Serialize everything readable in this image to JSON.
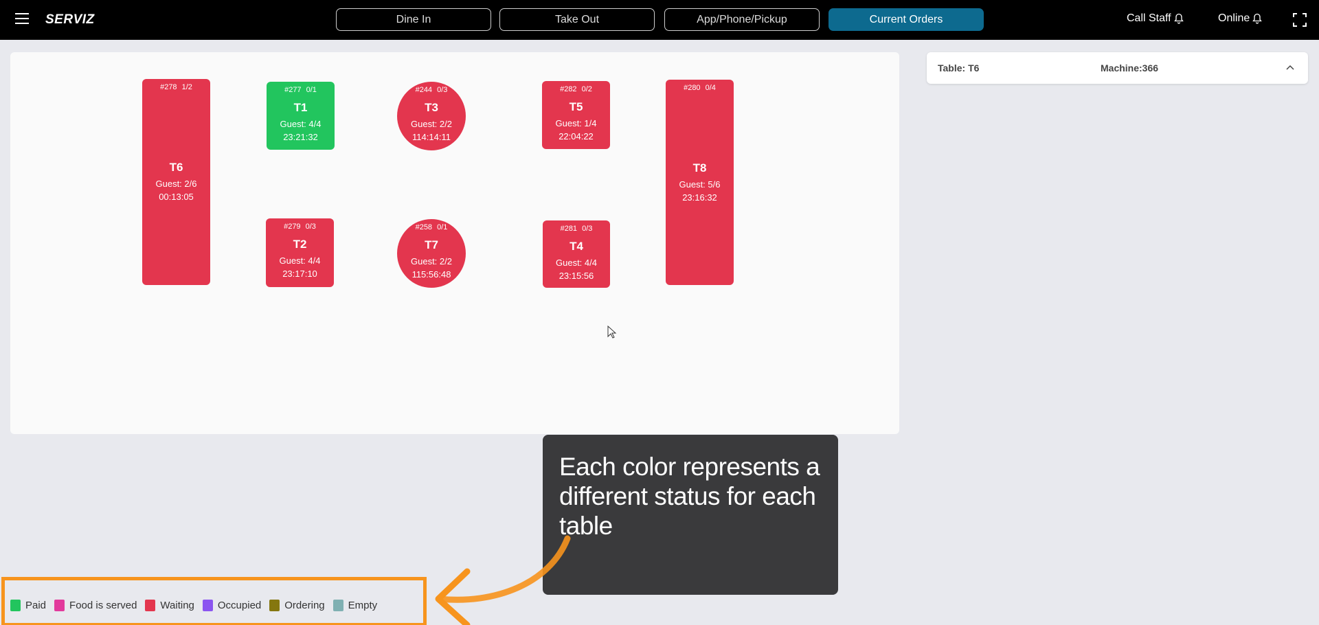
{
  "header": {
    "brand": "SERVIZ",
    "nav": [
      {
        "label": "Dine In",
        "active": false
      },
      {
        "label": "Take Out",
        "active": false
      },
      {
        "label": "App/Phone/Pickup",
        "active": false
      },
      {
        "label": "Current Orders",
        "active": true
      }
    ],
    "call_staff": "Call Staff",
    "online": "Online",
    "accent": "#0d6a8f"
  },
  "tables": [
    {
      "id": "T6",
      "order": "#278",
      "progress": "1/2",
      "guests": "Guest: 2/6",
      "time": "00:13:05",
      "shape": "rect",
      "status": "Waiting"
    },
    {
      "id": "T1",
      "order": "#277",
      "progress": "0/1",
      "guests": "Guest: 4/4",
      "time": "23:21:32",
      "shape": "square",
      "status": "Paid"
    },
    {
      "id": "T3",
      "order": "#244",
      "progress": "0/3",
      "guests": "Guest: 2/2",
      "time": "114:14:11",
      "shape": "round",
      "status": "Waiting"
    },
    {
      "id": "T5",
      "order": "#282",
      "progress": "0/2",
      "guests": "Guest: 1/4",
      "time": "22:04:22",
      "shape": "square",
      "status": "Waiting"
    },
    {
      "id": "T8",
      "order": "#280",
      "progress": "0/4",
      "guests": "Guest: 5/6",
      "time": "23:16:32",
      "shape": "rect",
      "status": "Waiting"
    },
    {
      "id": "T2",
      "order": "#279",
      "progress": "0/3",
      "guests": "Guest: 4/4",
      "time": "23:17:10",
      "shape": "square",
      "status": "Waiting"
    },
    {
      "id": "T7",
      "order": "#258",
      "progress": "0/1",
      "guests": "Guest: 2/2",
      "time": "115:56:48",
      "shape": "round",
      "status": "Waiting"
    },
    {
      "id": "T4",
      "order": "#281",
      "progress": "0/3",
      "guests": "Guest: 4/4",
      "time": "23:15:56",
      "shape": "square",
      "status": "Waiting"
    }
  ],
  "detail": {
    "table": "Table: T6",
    "machine": "Machine:366"
  },
  "legend": [
    {
      "label": "Paid",
      "color": "#22c55e"
    },
    {
      "label": "Food is served",
      "color": "#e23a9c"
    },
    {
      "label": "Waiting",
      "color": "#e3364e"
    },
    {
      "label": "Occupied",
      "color": "#8b55f0"
    },
    {
      "label": "Ordering",
      "color": "#85770f"
    },
    {
      "label": "Empty",
      "color": "#7fb0b2"
    }
  ],
  "tooltip": {
    "text": "Each color represents a different status for each table"
  },
  "highlight_color": "#f7941d"
}
